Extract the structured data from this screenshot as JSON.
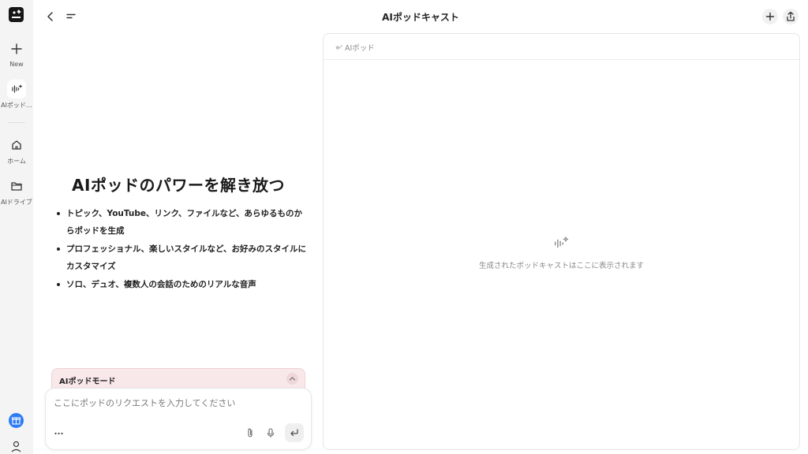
{
  "sidebar": {
    "new_label": "New",
    "podcast_label": "AIポッド…",
    "home_label": "ホーム",
    "drive_label": "AIドライブ"
  },
  "header": {
    "title": "AIポッドキャスト"
  },
  "hero": {
    "title": "AIポッドのパワーを解き放つ",
    "features": [
      "トピック、YouTube、リンク、ファイルなど、あらゆるものからポッドを生成",
      "プロフェッショナル、楽しいスタイルなど、お好みのスタイルにカスタマイズ",
      "ソロ、デュオ、複数人の会話のためのリアルな音声"
    ]
  },
  "mode": {
    "label": "AIポッドモード"
  },
  "input": {
    "placeholder": "ここにポッドのリクエストを入力してください",
    "value": ""
  },
  "panel": {
    "tab_label": "AIポッド",
    "empty_text": "生成されたポッドキャストはここに表示されます"
  },
  "colors": {
    "accent_blue": "#2e7cf6",
    "mode_bg": "#f9e8e9",
    "sidebar_bg": "#f4f4f5"
  },
  "icons": {
    "logo": "genspark-logo-icon",
    "new": "plus-icon",
    "podcast": "sound-wave-sparkle-icon",
    "home": "home-icon",
    "drive": "folder-icon",
    "gift": "gift-icon",
    "user": "user-icon",
    "back": "chevron-left-icon",
    "menu": "menu-lines-icon",
    "add": "plus-icon",
    "share": "share-icon",
    "more": "more-dots-icon",
    "attach": "paperclip-icon",
    "mic": "microphone-icon",
    "send": "enter-arrow-icon",
    "collapse": "chevron-up-icon"
  }
}
